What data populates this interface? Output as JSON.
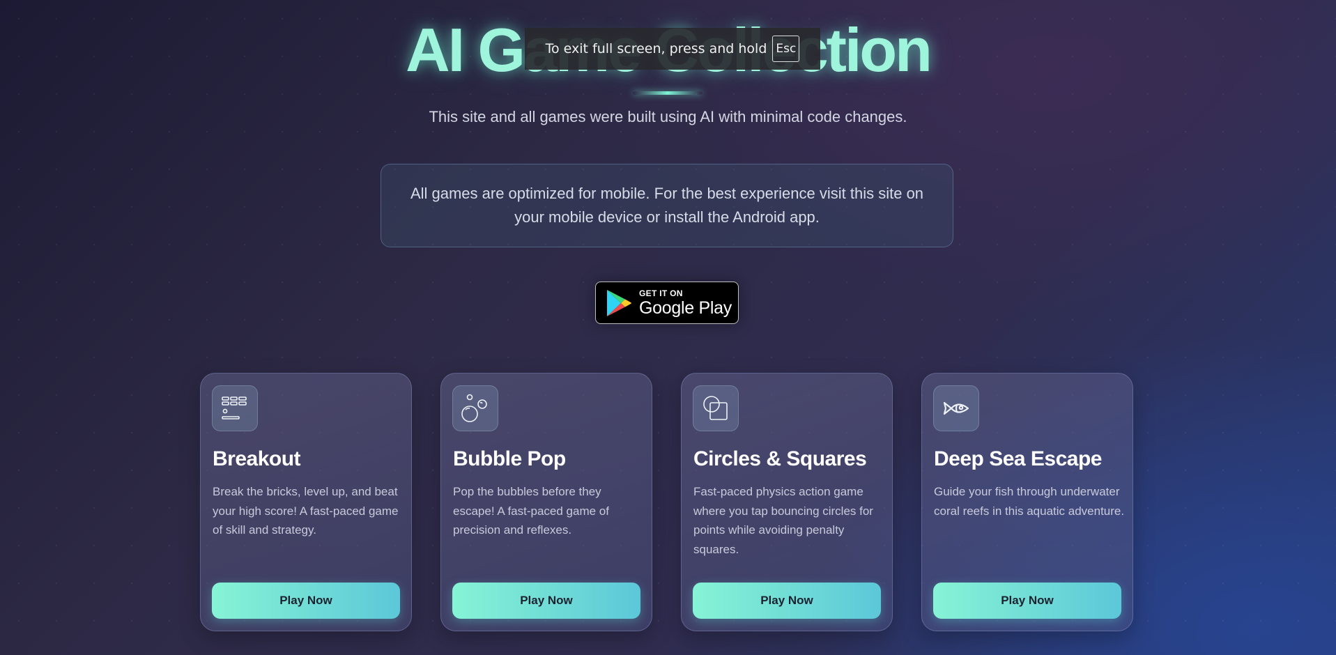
{
  "hero": {
    "title": "AI Game Collection",
    "subtitle": "This site and all games were built using AI with minimal code changes."
  },
  "notice": {
    "text": "All games are optimized for mobile. For the best experience visit this site on your mobile device or install the Android app."
  },
  "google_play": {
    "line1": "GET IT ON",
    "line2": "Google Play"
  },
  "fullscreen_toast": {
    "text": "To exit full screen, press and hold",
    "key": "Esc"
  },
  "games": [
    {
      "title": "Breakout",
      "description": "Break the bricks, level up, and beat your high score! A fast-paced game of skill and strategy.",
      "button": "Play Now",
      "icon": "bricks-icon"
    },
    {
      "title": "Bubble Pop",
      "description": "Pop the bubbles before they escape! A fast-paced game of precision and reflexes.",
      "button": "Play Now",
      "icon": "bubbles-icon"
    },
    {
      "title": "Circles & Squares",
      "description": "Fast-paced physics action game where you tap bouncing circles for points while avoiding penalty squares.",
      "button": "Play Now",
      "icon": "circle-square-icon"
    },
    {
      "title": "Deep Sea Escape",
      "description": "Guide your fish through underwater coral reefs in this aquatic adventure.",
      "button": "Play Now",
      "icon": "fish-icon"
    }
  ],
  "colors": {
    "accent": "#9ff5dc",
    "button_start": "#86f4d5",
    "button_end": "#5cc7d8"
  }
}
